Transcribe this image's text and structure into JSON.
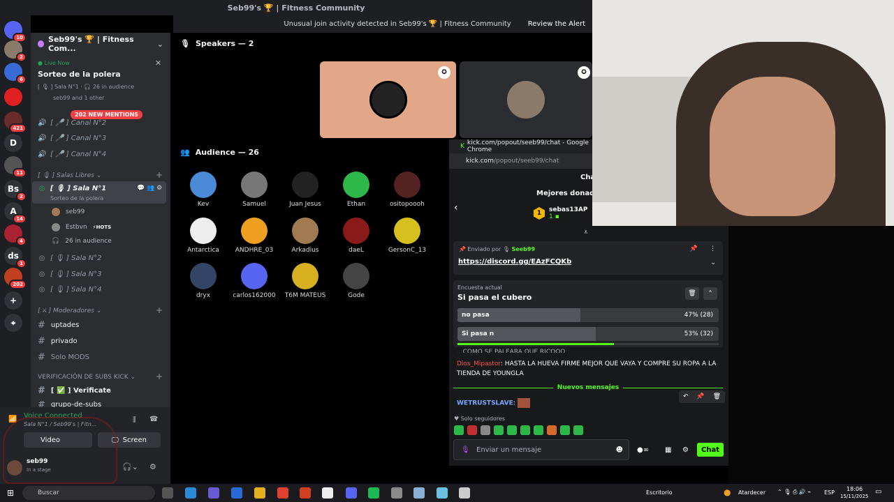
{
  "window": {
    "title": "Seb99's 🏆 | Fitness Community"
  },
  "alert": {
    "text": "Unusual join activity detected in Seb99's 🏆 | Fitness Community",
    "action": "Review the Alert"
  },
  "server_rail": {
    "servers": [
      {
        "label": "",
        "badge": "10",
        "color": "#5865f2"
      },
      {
        "label": "",
        "badge": "2",
        "color": "#8a7a6a"
      },
      {
        "label": "",
        "badge": "6",
        "color": "#3a6ad6"
      },
      {
        "label": "",
        "badge": "",
        "color": "#e02020"
      },
      {
        "label": "",
        "badge": "421",
        "color": "#6a2a2a"
      },
      {
        "label": "D",
        "badge": "",
        "color": "#313338"
      },
      {
        "label": "",
        "badge": "11",
        "color": "#555"
      },
      {
        "label": "Bs",
        "badge": "2",
        "color": "#313338"
      },
      {
        "label": "A",
        "badge": "14",
        "color": "#313338"
      },
      {
        "label": "",
        "badge": "4",
        "color": "#aa2233"
      },
      {
        "label": "ds",
        "badge": "1",
        "color": "#313338"
      },
      {
        "label": "",
        "badge": "202",
        "color": "#c04020"
      },
      {
        "label": "+",
        "badge": "",
        "color": "#313338"
      },
      {
        "label": "⌖",
        "badge": "",
        "color": "#313338"
      }
    ]
  },
  "sidebar": {
    "guild_name": "Seb99's 🏆 | Fitness Com...",
    "live_label": "Live Now",
    "event_title": "Sorteo de la polera",
    "event_sub": "[ 🎙 ] Sala N°1 · 🎧 26 in audience",
    "event_users": "seb99 and 1 other",
    "mentions": "202 NEW MENTIONS",
    "voice_channels_top": [
      "[ 🎤 ] Canal N°2",
      "[ 🎤 ] Canal N°3",
      "[ 🎤 ] Canal N°4"
    ],
    "category_salas": "[ 🎙 ] Salas Libres",
    "sala1": "[ 🎙 ] Sala N°1",
    "sala1_sub": "Sorteo de la polera",
    "sala1_members": [
      {
        "name": "seb99",
        "tag": ""
      },
      {
        "name": "Estbvn",
        "tag": "⚡HOTS"
      }
    ],
    "audience": "26 in audience",
    "other_salas": [
      "[ 🎙 ] Sala N°2",
      "[ 🎙 ] Sala N°3",
      "[ 🎙 ] Sala N°4"
    ],
    "category_mods": "[ ⚔ ] Moderadores",
    "mod_channels": [
      "uptades",
      "privado",
      "Solo MODS"
    ],
    "category_subs": "VERIFICACIÓN DE SUBS KICK",
    "verify_channel": "[ ✅ ] Verificate",
    "subs_group": "grupo-de-subs",
    "voice_connected": "Voice Connected",
    "voice_sub": "Sala N°1 / Seb99's | Fitn...",
    "video_label": "Video",
    "screen_label": "Screen",
    "user_name": "seb99",
    "user_status": "In a stage"
  },
  "stage": {
    "speakers_header": "Speakers — 2",
    "audience_header": "Audience — 26",
    "audience": [
      {
        "name": "Kev",
        "color": "#4a8ad6"
      },
      {
        "name": "Samuel",
        "color": "#777"
      },
      {
        "name": "Juan Jesus",
        "color": "#222"
      },
      {
        "name": "Ethan",
        "color": "#2fb84a"
      },
      {
        "name": "ositopoooh",
        "color": "#552222"
      },
      {
        "name": "Antarctica",
        "color": "#eee"
      },
      {
        "name": "ANDHRE_03",
        "color": "#f0a020"
      },
      {
        "name": "Arkadius",
        "color": "#a07a50"
      },
      {
        "name": "daeL",
        "color": "#8a1a1a"
      },
      {
        "name": "GersonC_13",
        "color": "#d6c020"
      },
      {
        "name": "dryx",
        "color": "#334466"
      },
      {
        "name": "carlos162000",
        "color": "#5865f2"
      },
      {
        "name": "T6M MATEUS",
        "color": "#d6b020"
      },
      {
        "name": "Gode",
        "color": "#444"
      }
    ]
  },
  "popout": {
    "window_title": "kick.com/popout/seeb99/chat - Google Chrome",
    "url_host": "kick.com",
    "url_path": "/popout/seeb99/chat",
    "chat_label": "Cha",
    "donors_title": "Mejores donadores",
    "top_donor": {
      "name": "sebas13AP",
      "rank": "1",
      "amount": "1"
    },
    "pinned_by": "Enviado por",
    "pinned_user": "Seeb99",
    "pinned_link": "https://discord.gg/EAzFCQKb",
    "poll_label": "Encuesta actual",
    "poll_question": "Si pasa el cubero",
    "poll_options": [
      {
        "label": "no pasa",
        "pct": 47,
        "text": "47% (28)"
      },
      {
        "label": "Si pasa n",
        "pct": 53,
        "text": "53% (32)"
      }
    ],
    "poll_time_left": 0.6,
    "msg_partial": "...COMO SE PALEARA QUE RICOOO",
    "msg1_user": "Dios_Mipastor",
    "msg1_text": "HASTA LA HUEVA FIRME MEJOR QUE VAYA Y COMPRE SU ROPA A LA TIENDA DE YOUNGLA",
    "new_messages": "Nuevos mensajes",
    "msg2_user": "WETRUSTSLAVE",
    "followers_only": "Solo seguidores",
    "input_placeholder": "Enviar un mensaje",
    "chat_button": "Chat"
  },
  "taskbar": {
    "search": "Buscar",
    "desktop": "Escritorio",
    "weather": "Atardecer",
    "lang": "ESP",
    "time": "18:06",
    "date": "15/11/2025"
  }
}
